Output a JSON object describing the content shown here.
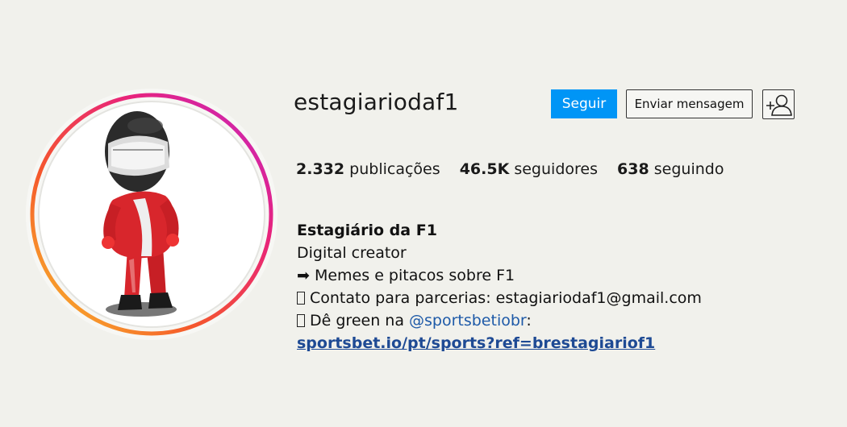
{
  "profile": {
    "username": "estagiariodaf1",
    "follow_label": "Seguir",
    "message_label": "Enviar mensagem",
    "add_user_icon": "add-user-icon"
  },
  "stats": {
    "posts_count": "2.332",
    "posts_label": "publicações",
    "followers_count": "46.5K",
    "followers_label": "seguidores",
    "following_count": "638",
    "following_label": "seguindo"
  },
  "bio": {
    "name": "Estagiário da F1",
    "category": "Digital creator",
    "line1_icon": "➡",
    "line1": "Memes e pitacos sobre F1",
    "line2": "Contato para parcerias: estagiariodaf1@gmail.com",
    "line3_prefix": "Dê green na ",
    "line3_mention": "@sportsbetiobr",
    "line3_suffix": ":",
    "link": "sportsbet.io/pt/sports?ref=brestagiariof1"
  },
  "colors": {
    "follow_button": "#0095f6",
    "ring_gradient": [
      "#f9b322",
      "#f5572c",
      "#e8237b",
      "#c227c8"
    ],
    "link": "#1e4a94"
  }
}
